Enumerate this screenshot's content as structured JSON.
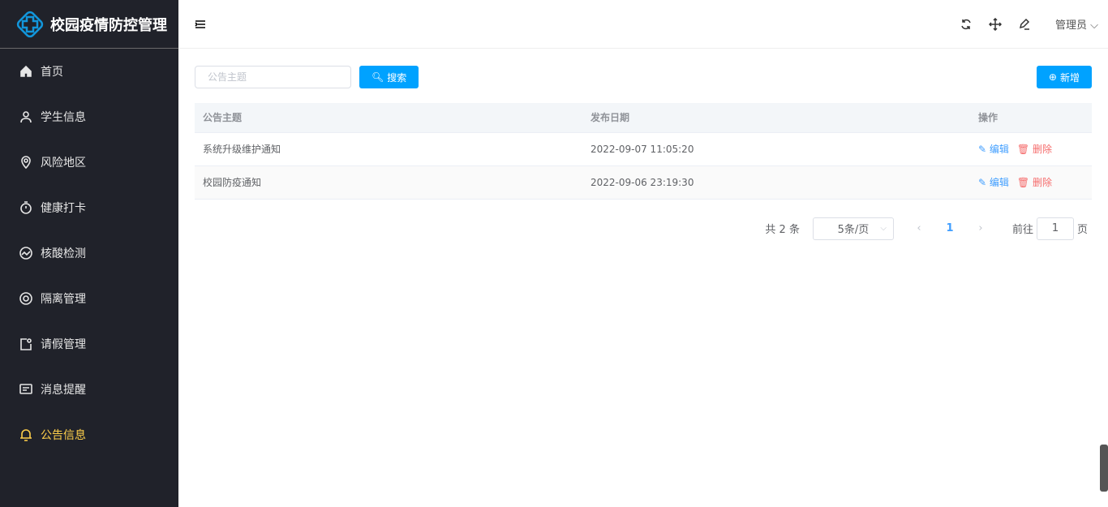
{
  "app": {
    "title": "校园疫情防控管理"
  },
  "sidebar": {
    "items": [
      {
        "label": "首页",
        "icon": "home-icon"
      },
      {
        "label": "学生信息",
        "icon": "user-icon"
      },
      {
        "label": "风险地区",
        "icon": "location-icon"
      },
      {
        "label": "健康打卡",
        "icon": "timer-icon"
      },
      {
        "label": "核酸检测",
        "icon": "chart-icon"
      },
      {
        "label": "隔离管理",
        "icon": "lifebuoy-icon"
      },
      {
        "label": "请假管理",
        "icon": "note-icon"
      },
      {
        "label": "消息提醒",
        "icon": "message-icon"
      },
      {
        "label": "公告信息",
        "icon": "bell-icon",
        "active": true
      }
    ]
  },
  "header": {
    "user": "管理员"
  },
  "search": {
    "placeholder": "公告主题",
    "button": "搜索",
    "add": "新增"
  },
  "table": {
    "columns": [
      "公告主题",
      "发布日期",
      "操作"
    ],
    "rows": [
      {
        "title": "系统升级维护通知",
        "date": "2022-09-07 11:05:20"
      },
      {
        "title": "校园防疫通知",
        "date": "2022-09-06 23:19:30"
      }
    ],
    "edit": "编辑",
    "delete": "删除"
  },
  "pagination": {
    "total": "共 2 条",
    "page_size": "5条/页",
    "current": "1",
    "goto_label": "前往",
    "goto_value": "1",
    "page_suffix": "页"
  },
  "colors": {
    "accent": "#00a2ff",
    "active": "#ffd04b",
    "sidebar": "#20222a"
  }
}
